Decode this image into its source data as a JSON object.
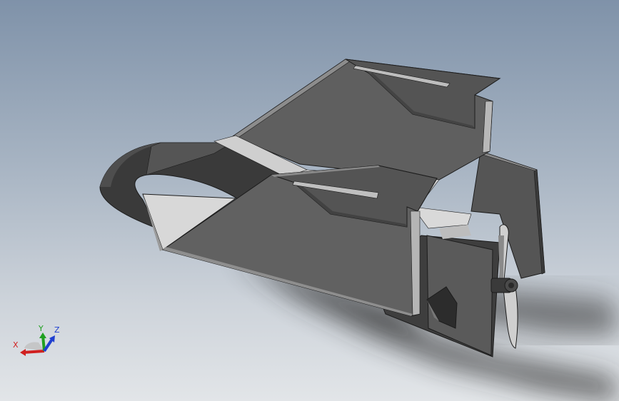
{
  "viewport": {
    "background_top": "#7f92a9",
    "background_bottom": "#e2e5e8"
  },
  "model": {
    "face_light": "#7a7a7a",
    "face_mid": "#5e5e5e",
    "face_dark": "#3a3a3a",
    "face_highlight": "#c8c8c8",
    "edge": "#1c1c1c",
    "shadow": "#2a2a2a"
  },
  "triad": {
    "x_label": "X",
    "y_label": "Y",
    "z_label": "Z",
    "x_color": "#d02020",
    "y_color": "#20a020",
    "z_color": "#2040d0"
  }
}
